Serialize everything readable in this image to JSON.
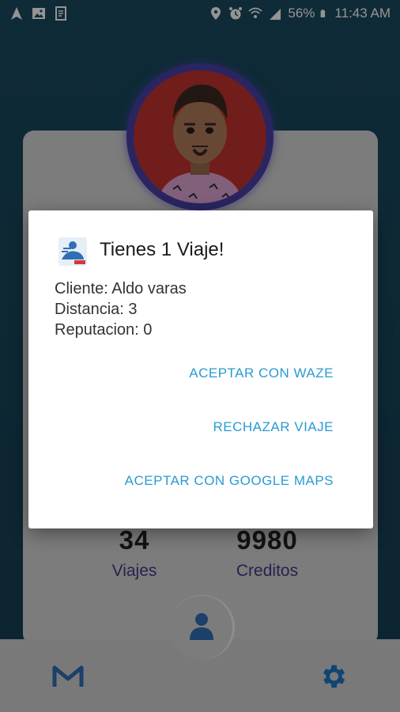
{
  "status_bar": {
    "battery_percent": "56%",
    "time": "11:43 AM"
  },
  "stats": {
    "trips_value": "34",
    "trips_label": "Viajes",
    "credits_value": "9980",
    "credits_label": "Creditos"
  },
  "dialog": {
    "title": "Tienes 1 Viaje!",
    "client_line": "Cliente: Aldo varas",
    "distance_line": "Distancia: 3",
    "reputation_line": "Reputacion: 0",
    "btn_waze": "ACEPTAR CON WAZE",
    "btn_reject": "RECHAZAR VIAJE",
    "btn_google": "ACEPTAR CON GOOGLE MAPS"
  },
  "colors": {
    "background": "#173f52",
    "accent": "#2a9bd1",
    "stat_label": "#3f3b8a",
    "settings_icon": "#1a78c8",
    "avatar_bg": "#c1332f"
  },
  "icons": {
    "nav_left": "gmail-m-icon",
    "nav_right": "settings-gear-icon",
    "profile": "person-icon",
    "dialog": "app-logo-icon"
  }
}
